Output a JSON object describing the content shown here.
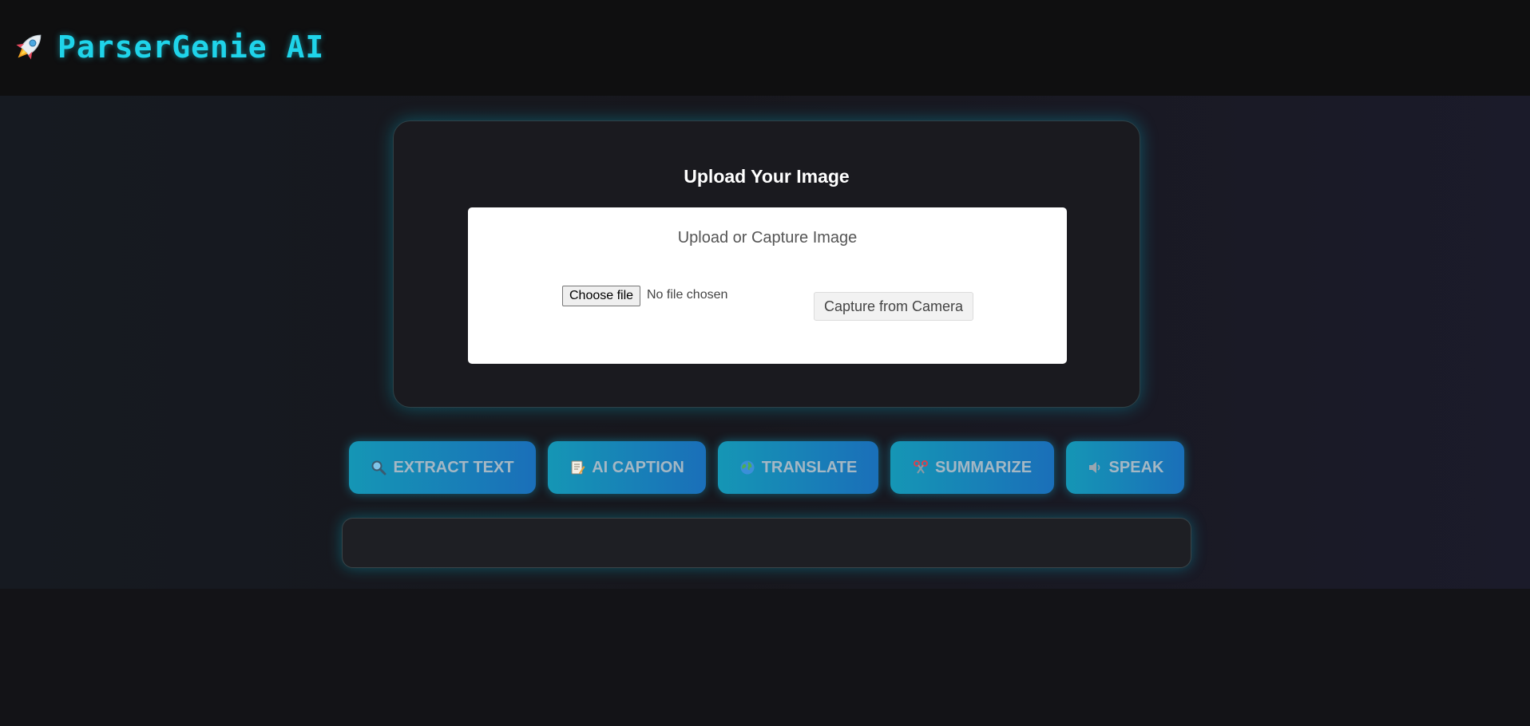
{
  "header": {
    "title": "ParserGenie AI",
    "icon": "rocket-icon"
  },
  "upload": {
    "heading": "Upload Your Image",
    "box_title": "Upload or Capture Image",
    "choose_file_label": "Choose file",
    "no_file_text": "No file chosen",
    "camera_label": "Capture from Camera"
  },
  "actions": [
    {
      "label": "EXTRACT TEXT",
      "icon": "magnifier-icon"
    },
    {
      "label": "AI CAPTION",
      "icon": "memo-icon"
    },
    {
      "label": "TRANSLATE",
      "icon": "globe-icon"
    },
    {
      "label": "SUMMARIZE",
      "icon": "scissors-icon"
    },
    {
      "label": "SPEAK",
      "icon": "speaker-icon"
    }
  ],
  "output": {
    "text": ""
  },
  "colors": {
    "brand": "#1fd4ea",
    "button_gradient_start": "#1596b5",
    "button_gradient_end": "#1a6fb9",
    "glow": "#00c8e6"
  }
}
